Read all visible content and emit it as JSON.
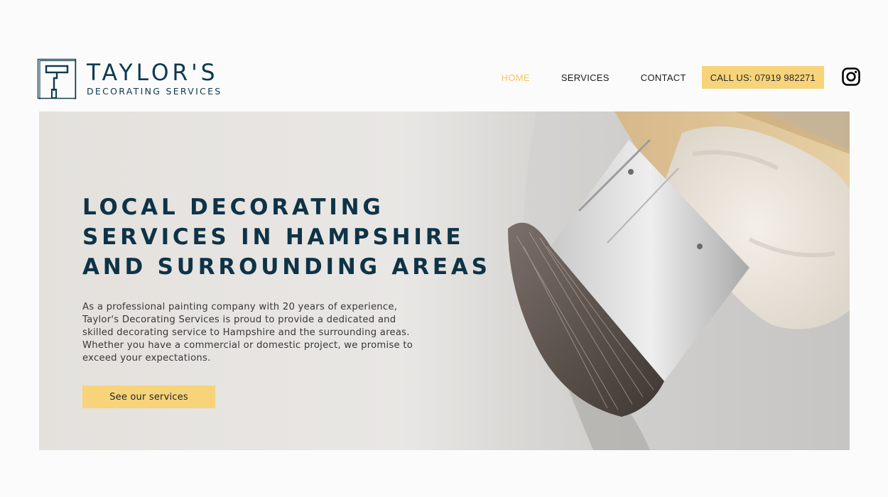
{
  "header": {
    "logo": {
      "title": "TAYLOR'S",
      "subtitle": "DECORATING SERVICES"
    },
    "nav": [
      {
        "label": "HOME",
        "active": true
      },
      {
        "label": "SERVICES",
        "active": false
      },
      {
        "label": "CONTACT",
        "active": false
      }
    ],
    "call_button": "CALL US: 07919 982271",
    "social_icon": "instagram-icon"
  },
  "hero": {
    "title_lines": [
      "LOCAL DECORATING",
      "SERVICES IN HAMPSHIRE",
      "AND SURROUNDING AREAS"
    ],
    "text": "As a professional painting company with 20 years of experience, Taylor's Decorating Services is proud to provide a dedicated and skilled decorating service to Hampshire and the surrounding areas. Whether you have a commercial or domestic project, we promise to exceed your expectations.",
    "cta_label": "See our services"
  },
  "colors": {
    "brand_navy": "#0d3a4f",
    "accent_yellow": "#f7d37a",
    "nav_active": "#f2c766"
  }
}
